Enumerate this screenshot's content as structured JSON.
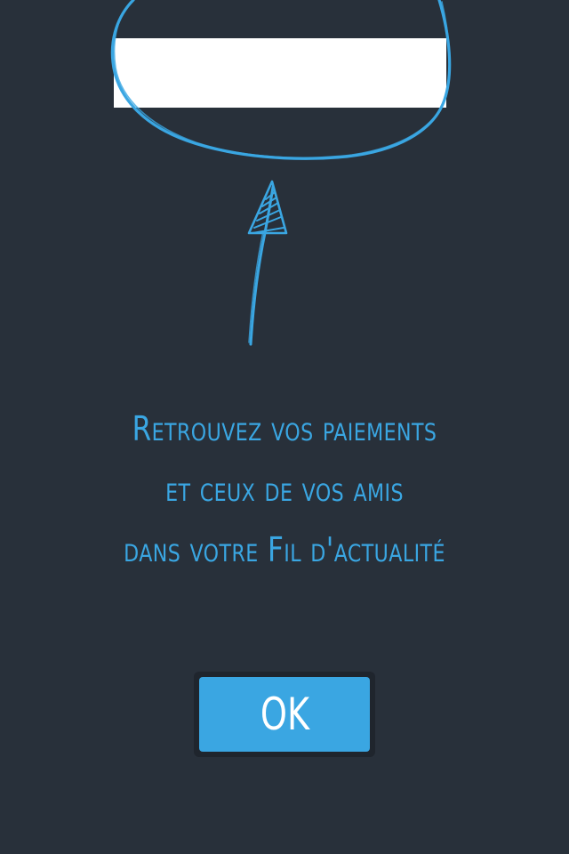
{
  "colors": {
    "background": "#28303a",
    "accent": "#3aa6e2",
    "highlight_bar": "#ffffff",
    "button_frame": "#1f252d",
    "button_text": "#ffffff"
  },
  "illustration": {
    "circle": "hand-drawn-circle-icon",
    "arrow": "hand-drawn-arrow-up-icon"
  },
  "message": {
    "line1": "Retrouvez vos paiements",
    "line2": "et ceux de vos amis",
    "line3": "dans votre Fil d'actualité"
  },
  "ok_button": {
    "label": "OK"
  }
}
